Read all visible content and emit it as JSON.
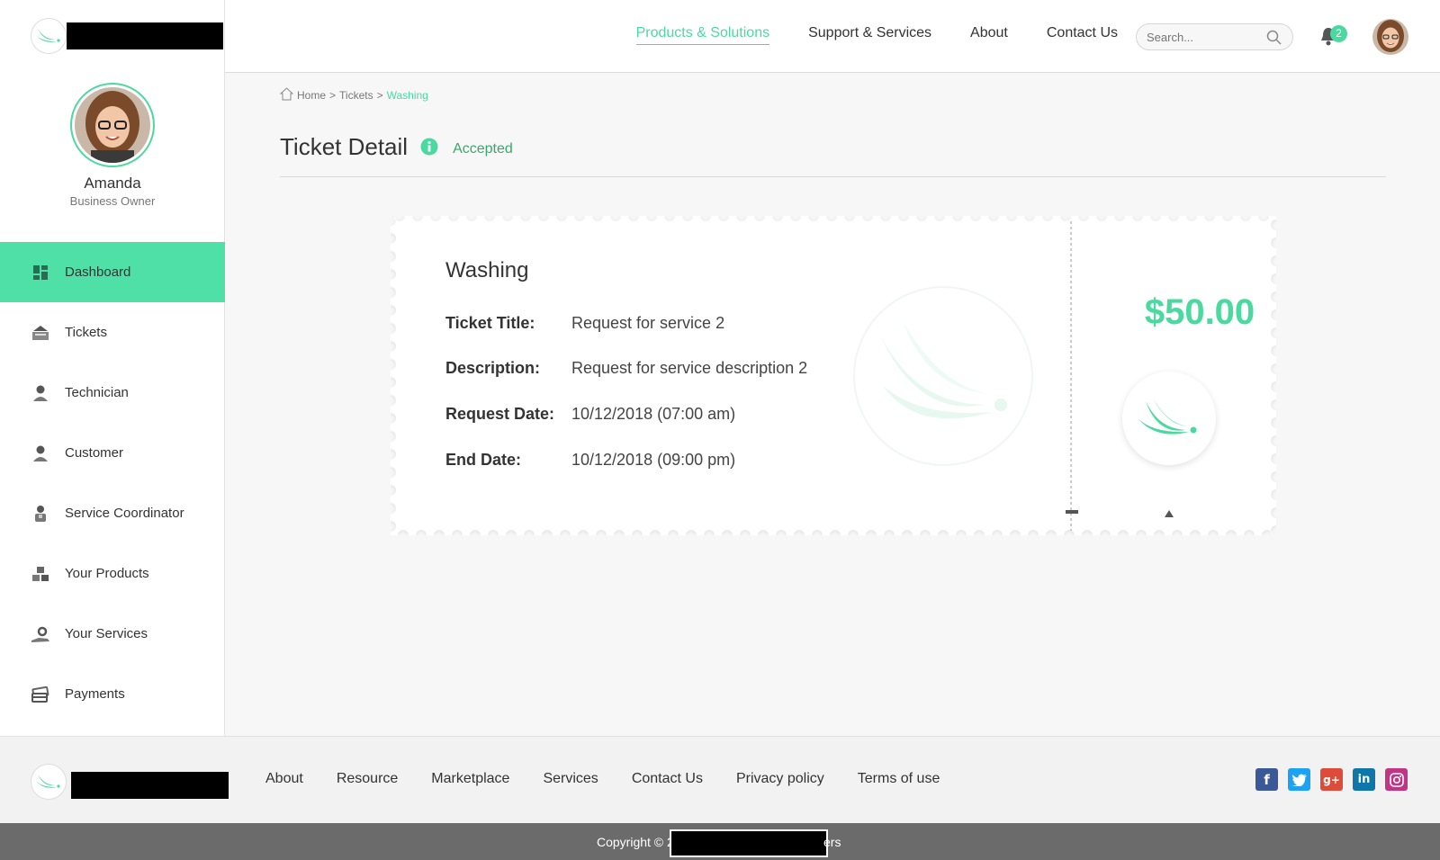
{
  "header": {
    "nav": [
      "Products & Solutions",
      "Support & Services",
      "About",
      "Contact Us"
    ],
    "active_nav": "Products & Solutions",
    "search_placeholder": "Search...",
    "notification_count": "2",
    "accent_color": "#4cd9a0"
  },
  "profile": {
    "name": "Amanda",
    "role": "Business Owner"
  },
  "sidebar": {
    "items": [
      {
        "label": "Dashboard",
        "icon": "dashboard-icon"
      },
      {
        "label": "Tickets",
        "icon": "tickets-icon"
      },
      {
        "label": "Technician",
        "icon": "technician-icon"
      },
      {
        "label": "Customer",
        "icon": "customer-icon"
      },
      {
        "label": "Service Coordinator",
        "icon": "coordinator-icon"
      },
      {
        "label": "Your Products",
        "icon": "products-icon"
      },
      {
        "label": "Your Services",
        "icon": "services-icon"
      },
      {
        "label": "Payments",
        "icon": "payments-icon"
      }
    ],
    "active_color": "#4fe0a8"
  },
  "breadcrumb": {
    "items": [
      "Home",
      "Tickets",
      "Washing"
    ],
    "separator": ">"
  },
  "page": {
    "title": "Ticket Detail",
    "status": "Accepted"
  },
  "ticket": {
    "heading": "Washing",
    "fields": [
      {
        "label": "Ticket Title:",
        "value": "Request for service 2"
      },
      {
        "label": "Description:",
        "value": "Request for service description 2"
      },
      {
        "label": "Request Date:",
        "value": "10/12/2018 (07:00 am)"
      },
      {
        "label": "End Date:",
        "value": "10/12/2018 (09:00 pm)"
      }
    ],
    "price": "$50.00"
  },
  "footer": {
    "links": [
      "About",
      "Resource",
      "Marketplace",
      "Services",
      "Contact Us",
      "Privacy policy",
      "Terms of use"
    ],
    "social": [
      "facebook-icon",
      "twitter-icon",
      "google-plus-icon",
      "linkedin-icon",
      "instagram-icon"
    ],
    "copyright_prefix": "Copyright © 2",
    "copyright_suffix": "ers"
  }
}
